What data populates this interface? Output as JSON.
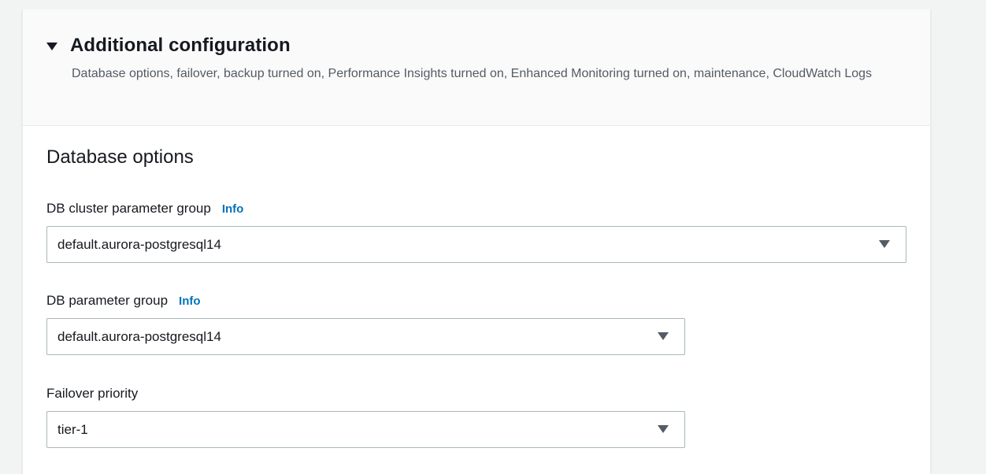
{
  "additional_configuration": {
    "title": "Additional configuration",
    "description": "Database options, failover, backup turned on, Performance Insights turned on, Enhanced Monitoring turned on, maintenance, CloudWatch Logs"
  },
  "database_options": {
    "title": "Database options",
    "fields": [
      {
        "label": "DB cluster parameter group",
        "info": "Info",
        "value": "default.aurora-postgresql14"
      },
      {
        "label": "DB parameter group",
        "info": "Info",
        "value": "default.aurora-postgresql14"
      },
      {
        "label": "Failover priority",
        "value": "tier-1"
      }
    ]
  },
  "icons": {
    "expand": "caret-down-icon",
    "dropdown": "dropdown-caret-icon"
  },
  "colors": {
    "link": "#0073bb",
    "border": "#aab7b8",
    "header_background": "#fafafa"
  }
}
